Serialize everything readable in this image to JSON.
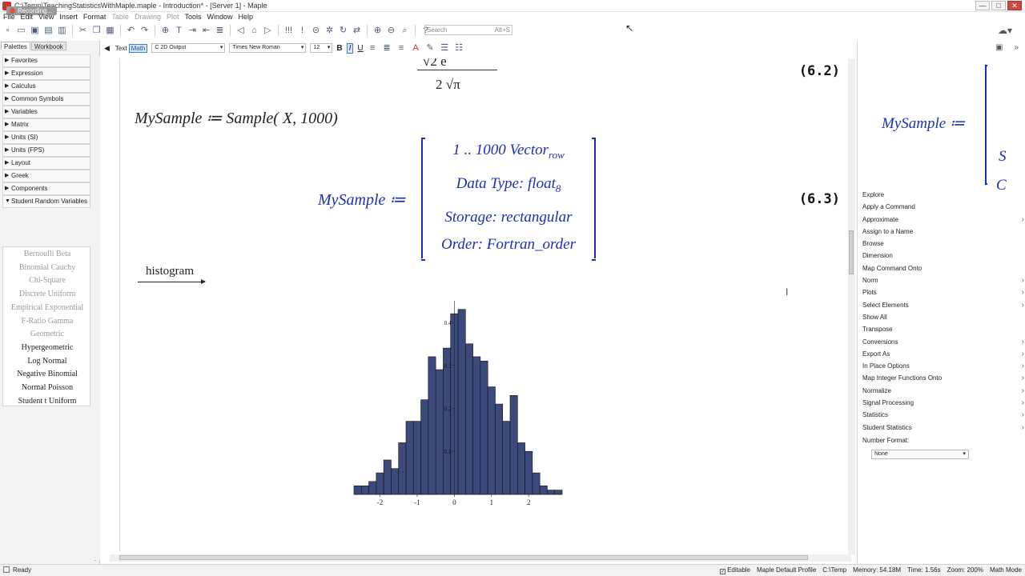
{
  "window": {
    "title": "C:\\Temp\\TeachingStatisticsWithMaple.maple - Introduction* - [Server 1] - Maple",
    "recording_label": "Recording...",
    "controls": [
      "—",
      "□",
      "✕"
    ]
  },
  "menu": [
    "File",
    "Edit",
    "View",
    "Insert",
    "Format",
    "Table",
    "Drawing",
    "Plot",
    "Tools",
    "Window",
    "Help"
  ],
  "menu_disabled": [
    "Table",
    "Drawing",
    "Plot"
  ],
  "toolbar": {
    "search_placeholder": "Search",
    "search_shortcut": "Alt+S"
  },
  "context_bar": {
    "text_label": "Text",
    "math_label": "Math",
    "style_value": "C  2D Output",
    "font_value": "Times New Roman",
    "size_value": "12",
    "bold": "B",
    "italic": "I",
    "underline": "U"
  },
  "palette": {
    "tabs": [
      "Palettes",
      "Workbook"
    ],
    "sections": [
      "Favorites",
      "Expression",
      "Calculus",
      "Common Symbols",
      "Variables",
      "Matrix",
      "Units (SI)",
      "Units (FPS)",
      "Layout",
      "Greek",
      "Components",
      "Student Random Variables"
    ],
    "random_variables": [
      {
        "text": "Bernoulli   Beta",
        "gray": true
      },
      {
        "text": "Binomial  Cauchy",
        "gray": true
      },
      {
        "text": "Chi-Square",
        "gray": true
      },
      {
        "text": "Discrete Uniform",
        "gray": true
      },
      {
        "text": "Empirical  Exponential",
        "gray": true
      },
      {
        "text": "F-Ratio  Gamma",
        "gray": true
      },
      {
        "text": "Geometric",
        "gray": true
      },
      {
        "text": "Hypergeometric",
        "gray": false
      },
      {
        "text": "Log Normal",
        "gray": false
      },
      {
        "text": "Negative Binomial",
        "gray": false
      },
      {
        "text": "Normal  Poisson",
        "gray": false
      },
      {
        "text": "Student t  Uniform",
        "gray": false
      }
    ]
  },
  "document": {
    "frac_top": "√2  e",
    "frac_bottom": "2 √π",
    "eq1_number": "(6.2)",
    "input_line": "MySample ≔ Sample( X, 1000)",
    "output_lhs": "MySample ≔",
    "matrix_rows": [
      "1 .. 1000 Vector",
      "Data Type: float",
      "Storage: rectangular",
      "Order: Fortran_order"
    ],
    "matrix_subs": [
      "row",
      "8",
      "",
      ""
    ],
    "eq2_number": "(6.3)",
    "histogram_label": "histogram"
  },
  "chart_data": {
    "type": "bar",
    "title": "",
    "xlabel": "",
    "ylabel": "",
    "xlim": [
      -2.7,
      2.9
    ],
    "ylim": [
      0,
      0.45
    ],
    "x_ticks": [
      "-2",
      "-1",
      "0",
      "1",
      "2"
    ],
    "y_ticks": [
      "0.1",
      "0.2",
      "0.3",
      "0.4"
    ],
    "bar_color": "#3b4a7a",
    "bins": [
      [
        -2.7,
        0.02
      ],
      [
        -2.5,
        0.02
      ],
      [
        -2.3,
        0.03
      ],
      [
        -2.1,
        0.05
      ],
      [
        -1.9,
        0.08
      ],
      [
        -1.7,
        0.06
      ],
      [
        -1.5,
        0.12
      ],
      [
        -1.3,
        0.17
      ],
      [
        -1.1,
        0.17
      ],
      [
        -0.9,
        0.22
      ],
      [
        -0.7,
        0.32
      ],
      [
        -0.5,
        0.29
      ],
      [
        -0.3,
        0.34
      ],
      [
        -0.1,
        0.42
      ],
      [
        0.1,
        0.43
      ],
      [
        0.3,
        0.35
      ],
      [
        0.5,
        0.32
      ],
      [
        0.7,
        0.31
      ],
      [
        0.9,
        0.25
      ],
      [
        1.1,
        0.21
      ],
      [
        1.3,
        0.17
      ],
      [
        1.5,
        0.23
      ],
      [
        1.7,
        0.12
      ],
      [
        1.9,
        0.1
      ],
      [
        2.1,
        0.05
      ],
      [
        2.3,
        0.02
      ],
      [
        2.5,
        0.01
      ],
      [
        2.7,
        0.01
      ]
    ],
    "bin_width": 0.2
  },
  "right_panel": {
    "preview_lhs": "MySample ≔",
    "preview_c1": "S",
    "preview_c2": "C",
    "menu": [
      {
        "label": "Explore",
        "sub": false
      },
      {
        "label": "Apply a Command",
        "sub": false
      },
      {
        "label": "Approximate",
        "sub": true
      },
      {
        "label": "Assign to a Name",
        "sub": false
      },
      {
        "label": "Browse",
        "sub": false
      },
      {
        "label": "Dimension",
        "sub": false
      },
      {
        "label": "Map Command Onto",
        "sub": false
      },
      {
        "label": "Norm",
        "sub": true
      },
      {
        "label": "Plots",
        "sub": true
      },
      {
        "label": "Select Elements",
        "sub": true
      },
      {
        "label": "Show All",
        "sub": false
      },
      {
        "label": "Transpose",
        "sub": false
      },
      {
        "label": "Conversions",
        "sub": true
      },
      {
        "label": "Export As",
        "sub": true
      },
      {
        "label": "In Place Options",
        "sub": true
      },
      {
        "label": "Map Integer Functions Onto",
        "sub": true
      },
      {
        "label": "Normalize",
        "sub": true
      },
      {
        "label": "Signal Processing",
        "sub": true
      },
      {
        "label": "Statistics",
        "sub": true
      },
      {
        "label": "Student Statistics",
        "sub": true
      }
    ],
    "number_format_label": "Number Format:",
    "number_format_value": "None"
  },
  "status": {
    "ready": "Ready",
    "editable": "Editable",
    "profile": "Maple Default Profile",
    "path": "C:\\Temp",
    "memory": "Memory: 54.18M",
    "time": "Time: 1.56s",
    "zoom": "Zoom: 200%",
    "mode": "Math Mode"
  }
}
